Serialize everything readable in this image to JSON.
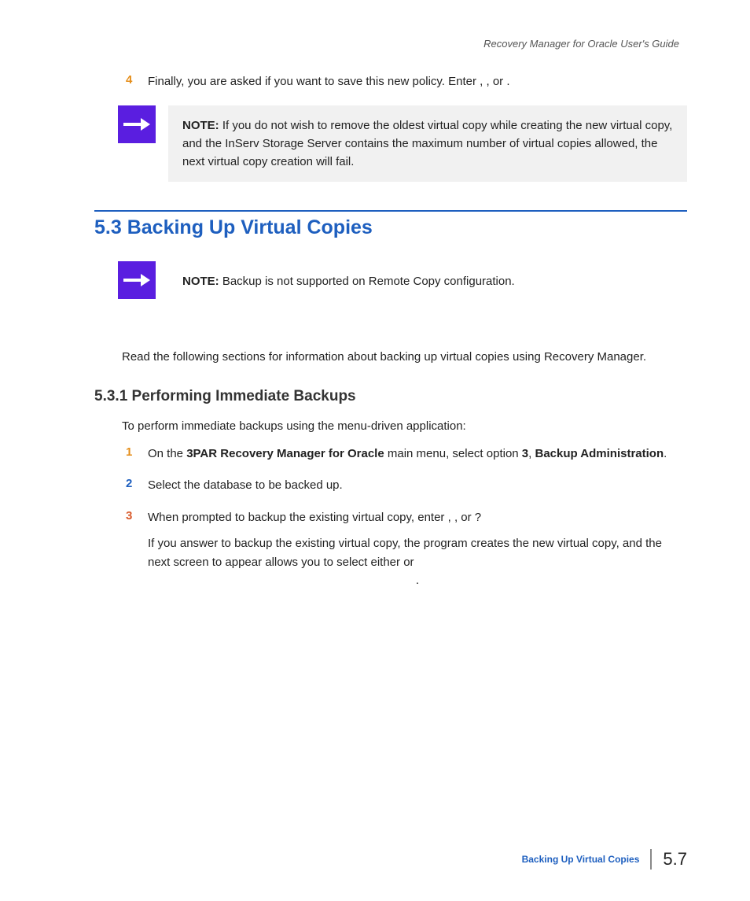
{
  "header": {
    "doc_title": "Recovery Manager for Oracle User's Guide"
  },
  "step4": {
    "num": "4",
    "text_a": "Finally, you are asked if you want to save this new policy. Enter ",
    "text_b": ", ",
    "text_c": ", or ",
    "text_d": "."
  },
  "note1": {
    "label": "NOTE:",
    "text": " If you do not wish to remove the oldest virtual copy while creating the new virtual copy, and the InServ Storage Server contains the maximum number of virtual copies allowed, the next virtual copy creation will fail."
  },
  "section": {
    "number": "5.3",
    "title": "Backing Up Virtual Copies"
  },
  "note2": {
    "label": "NOTE:",
    "text": "  Backup is not supported on Remote Copy configuration."
  },
  "intro": "Read the following sections for information about backing up virtual copies using Recovery Manager.",
  "subsection": {
    "full": "5.3.1 Performing Immediate Backups"
  },
  "sub_intro": "To perform immediate backups using the menu-driven application:",
  "step1": {
    "num": "1",
    "a": "On the ",
    "b": "3PAR Recovery Manager for Oracle",
    "c": " main menu, select option ",
    "d": "3",
    "e": ", ",
    "f": "Backup Administration",
    "g": "."
  },
  "step2": {
    "num": "2",
    "text": "Select the database to be backed up."
  },
  "step3": {
    "num": "3",
    "a": "When prompted to backup the existing virtual copy, enter ",
    "b": ", ",
    "c": ", or ",
    "d": "?",
    "follow_a": "If you answer ",
    "follow_b": " to backup the existing virtual copy, the program creates the new virtual copy, and the next screen to appear allows you to select either ",
    "follow_c": " or ",
    "follow_d": "."
  },
  "footer": {
    "section": "Backing Up Virtual Copies",
    "page": "5.7"
  }
}
